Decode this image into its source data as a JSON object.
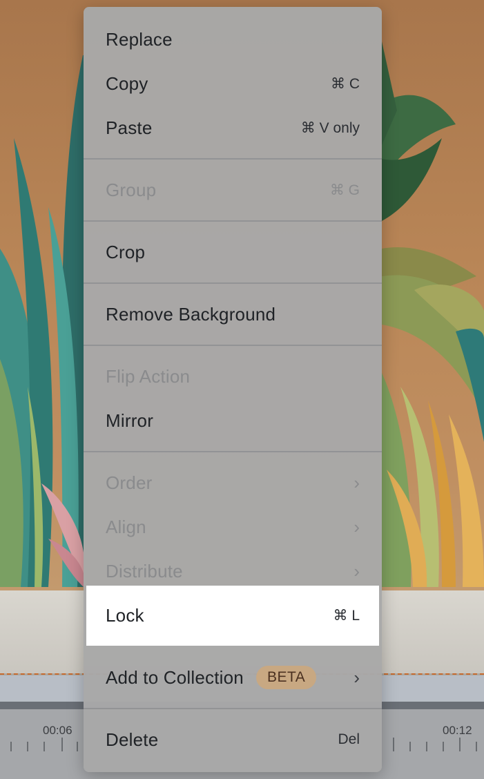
{
  "menu": {
    "replace": {
      "label": "Replace"
    },
    "copy": {
      "label": "Copy",
      "shortcut": "⌘ C"
    },
    "paste": {
      "label": "Paste",
      "shortcut": "⌘ V only"
    },
    "group": {
      "label": "Group",
      "shortcut": "⌘ G",
      "disabled": true
    },
    "crop": {
      "label": "Crop"
    },
    "remove_background": {
      "label": "Remove Background"
    },
    "flip_action": {
      "label": "Flip Action",
      "disabled": true
    },
    "mirror": {
      "label": "Mirror"
    },
    "order": {
      "label": "Order",
      "submenu_icon": "chevron-right-icon",
      "disabled": true
    },
    "align": {
      "label": "Align",
      "submenu_icon": "chevron-right-icon",
      "disabled": true
    },
    "distribute": {
      "label": "Distribute",
      "submenu_icon": "chevron-right-icon",
      "disabled": true
    },
    "lock": {
      "label": "Lock",
      "shortcut": "⌘ L",
      "highlighted": true
    },
    "add_to_collection": {
      "label": "Add to Collection",
      "badge": "BETA",
      "submenu_icon": "chevron-right-icon"
    },
    "delete": {
      "label": "Delete",
      "shortcut": "Del"
    }
  },
  "timeline": {
    "time_left": "00:06",
    "time_right": "00:12"
  },
  "colors": {
    "menu_bg": "#a8a8a8",
    "highlight": "#ffffff",
    "badge_bg": "#c8a882",
    "dashed_line": "#c66a2e"
  }
}
